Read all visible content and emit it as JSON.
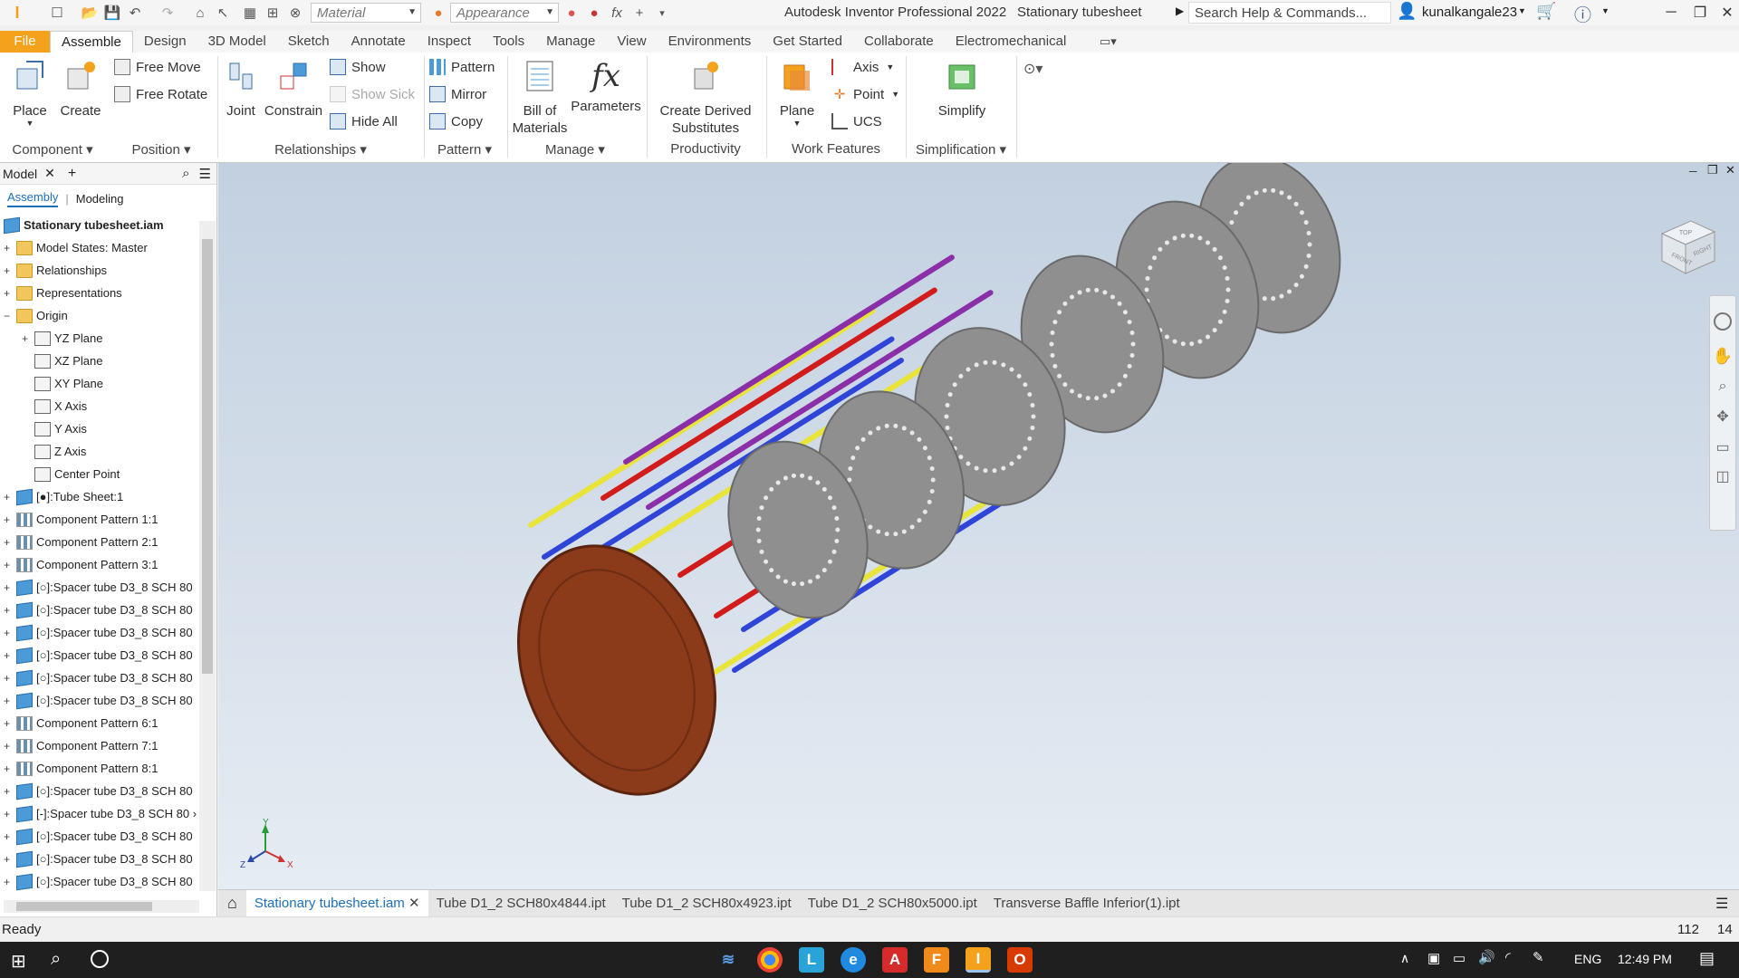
{
  "titlebar": {
    "material_placeholder": "Material",
    "appearance_placeholder": "Appearance",
    "app_title": "Autodesk Inventor Professional 2022",
    "doc_title": "Stationary tubesheet",
    "search_placeholder": "Search Help & Commands...",
    "user": "kunalkangale23"
  },
  "ribbon_tabs": [
    "File",
    "Assemble",
    "Design",
    "3D Model",
    "Sketch",
    "Annotate",
    "Inspect",
    "Tools",
    "Manage",
    "View",
    "Environments",
    "Get Started",
    "Collaborate",
    "Electromechanical"
  ],
  "ribbon": {
    "place": "Place",
    "create": "Create",
    "free_move": "Free Move",
    "free_rotate": "Free Rotate",
    "joint": "Joint",
    "constrain": "Constrain",
    "show": "Show",
    "show_sick": "Show Sick",
    "hide_all": "Hide All",
    "pattern": "Pattern",
    "mirror": "Mirror",
    "copy": "Copy",
    "bom_line1": "Bill of",
    "bom_line2": "Materials",
    "parameters": "Parameters",
    "derived_line1": "Create Derived",
    "derived_line2": "Substitutes",
    "plane": "Plane",
    "axis": "Axis",
    "point": "Point",
    "ucs": "UCS",
    "simplify": "Simplify",
    "groups": {
      "component": "Component",
      "position": "Position",
      "relationships": "Relationships",
      "pattern": "Pattern",
      "manage": "Manage",
      "productivity": "Productivity",
      "work_features": "Work Features",
      "simplification": "Simplification"
    }
  },
  "browser": {
    "tab": "Model",
    "sub_assembly": "Assembly",
    "sub_modeling": "Modeling",
    "root": "Stationary tubesheet.iam",
    "items": [
      {
        "label": "Model States: Master",
        "exp": "+",
        "icon": "folder",
        "indent": 0
      },
      {
        "label": "Relationships",
        "exp": "+",
        "icon": "folder",
        "indent": 0
      },
      {
        "label": "Representations",
        "exp": "+",
        "icon": "folder",
        "indent": 0
      },
      {
        "label": "Origin",
        "exp": "−",
        "icon": "folder",
        "indent": 0
      },
      {
        "label": "YZ Plane",
        "exp": "+",
        "icon": "plane",
        "indent": 1
      },
      {
        "label": "XZ Plane",
        "exp": "",
        "icon": "plane",
        "indent": 1
      },
      {
        "label": "XY Plane",
        "exp": "",
        "icon": "plane",
        "indent": 1
      },
      {
        "label": "X Axis",
        "exp": "",
        "icon": "plane",
        "indent": 1
      },
      {
        "label": "Y Axis",
        "exp": "",
        "icon": "plane",
        "indent": 1
      },
      {
        "label": "Z Axis",
        "exp": "",
        "icon": "plane",
        "indent": 1
      },
      {
        "label": "Center Point",
        "exp": "",
        "icon": "point",
        "indent": 1
      },
      {
        "label": "[●]:Tube Sheet:1",
        "exp": "+",
        "icon": "part",
        "indent": 0
      },
      {
        "label": "Component Pattern 1:1",
        "exp": "+",
        "icon": "pattern",
        "indent": 0
      },
      {
        "label": "Component Pattern 2:1",
        "exp": "+",
        "icon": "pattern",
        "indent": 0
      },
      {
        "label": "Component Pattern 3:1",
        "exp": "+",
        "icon": "pattern",
        "indent": 0
      },
      {
        "label": "[○]:Spacer tube D3_8 SCH 80",
        "exp": "+",
        "icon": "part",
        "indent": 0
      },
      {
        "label": "[○]:Spacer tube D3_8 SCH 80",
        "exp": "+",
        "icon": "part",
        "indent": 0
      },
      {
        "label": "[○]:Spacer tube D3_8 SCH 80",
        "exp": "+",
        "icon": "part",
        "indent": 0
      },
      {
        "label": "[○]:Spacer tube D3_8 SCH 80",
        "exp": "+",
        "icon": "part",
        "indent": 0
      },
      {
        "label": "[○]:Spacer tube D3_8 SCH 80",
        "exp": "+",
        "icon": "part",
        "indent": 0
      },
      {
        "label": "[○]:Spacer tube D3_8 SCH 80",
        "exp": "+",
        "icon": "part",
        "indent": 0
      },
      {
        "label": "Component Pattern 6:1",
        "exp": "+",
        "icon": "pattern",
        "indent": 0
      },
      {
        "label": "Component Pattern 7:1",
        "exp": "+",
        "icon": "pattern",
        "indent": 0
      },
      {
        "label": "Component Pattern 8:1",
        "exp": "+",
        "icon": "pattern",
        "indent": 0
      },
      {
        "label": "[○]:Spacer tube D3_8 SCH 80",
        "exp": "+",
        "icon": "part",
        "indent": 0
      },
      {
        "label": "[-]:Spacer tube D3_8 SCH 80 ›",
        "exp": "+",
        "icon": "part",
        "indent": 0
      },
      {
        "label": "[○]:Spacer tube D3_8 SCH 80",
        "exp": "+",
        "icon": "part",
        "indent": 0
      },
      {
        "label": "[○]:Spacer tube D3_8 SCH 80",
        "exp": "+",
        "icon": "part",
        "indent": 0
      },
      {
        "label": "[○]:Spacer tube D3_8 SCH 80",
        "exp": "+",
        "icon": "part",
        "indent": 0
      }
    ]
  },
  "viewcube": {
    "top": "TOP",
    "front": "FRONT",
    "right": "RIGHT"
  },
  "triad": {
    "x": "X",
    "y": "Y",
    "z": "Z"
  },
  "doc_tabs": [
    "Stationary tubesheet.iam",
    "Tube D1_2 SCH80x4844.ipt",
    "Tube D1_2 SCH80x4923.ipt",
    "Tube D1_2 SCH80x5000.ipt",
    "Transverse Baffle Inferior(1).ipt"
  ],
  "status": {
    "text": "Ready",
    "count1": "112",
    "count2": "14"
  },
  "taskbar": {
    "lang": "ENG",
    "time": "12:49 PM"
  },
  "colors": {
    "file_tab": "#f4a21b",
    "tubesheet": "#8b3a1a",
    "accent": "#1e6fb8"
  }
}
